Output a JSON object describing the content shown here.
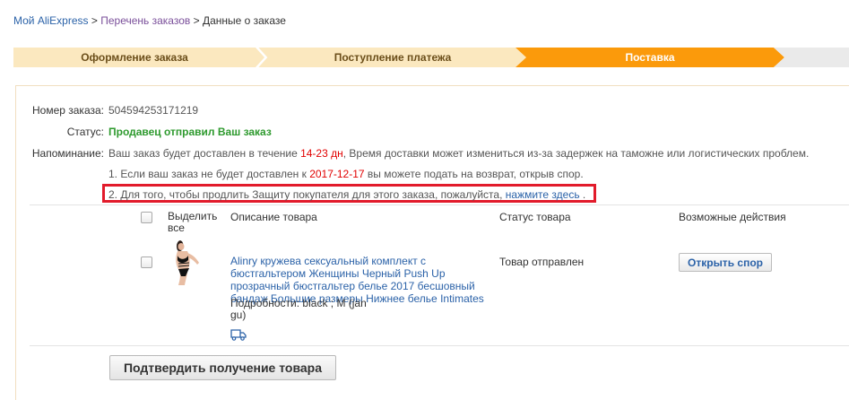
{
  "breadcrumb": {
    "home": "Мой AliExpress",
    "sep1": " > ",
    "orders": "Перечень заказов",
    "sep2": " > ",
    "current": "Данные о заказе"
  },
  "steps": [
    {
      "label": "Оформление заказа",
      "state": "done"
    },
    {
      "label": "Поступление платежа",
      "state": "done"
    },
    {
      "label": "Поставка",
      "state": "active"
    },
    {
      "label": "",
      "state": "pending"
    }
  ],
  "colors": {
    "step_done": "#fbe8bf",
    "step_active": "#fb9a0b",
    "step_pending": "#eaeaea",
    "highlight_border": "#e21b2b",
    "link": "#2b62a8",
    "status_green": "#2e9a2e",
    "accent_red": "#e10000"
  },
  "order": {
    "number_label": "Номер заказа:",
    "number": "504594253171219",
    "status_label": "Статус:",
    "status": "Продавец отправил Ваш заказ",
    "reminder_label": "Напоминание:",
    "reminder_pre": "Ваш заказ будет доставлен в течение ",
    "reminder_days": "14-23 дн",
    "reminder_post": ", Время доставки может измениться из-за задержек на таможне или логистических проблем.",
    "note1_pre": "1. Если ваш заказ не будет доставлен к ",
    "note1_date": "2017-12-17",
    "note1_post": " вы можете подать на возврат, открыв спор.",
    "note2_pre": "2. Для того, чтобы продлить Защиту покупателя для этого заказа, пожалуйста, ",
    "note2_link": "нажмите здесь",
    "note2_post": " ."
  },
  "table": {
    "headers": {
      "select_all": "Выделить все",
      "description": "Описание товара",
      "status": "Статус товара",
      "actions": "Возможные действия"
    },
    "rows": [
      {
        "title": "Alinry кружева сексуальный комплект с бюстгальтером Женщины Черный Push Up прозрачный бюстгальтер белье 2017 бесшовный бандаж Большие размеры Нижнее белье Intimates",
        "details": "Подробности: black   ; M (jan gu)",
        "status": "Товар отправлен",
        "action": "Открыть спор",
        "icon": "truck-icon"
      }
    ]
  },
  "confirm_button": "Подтвердить получение товара"
}
